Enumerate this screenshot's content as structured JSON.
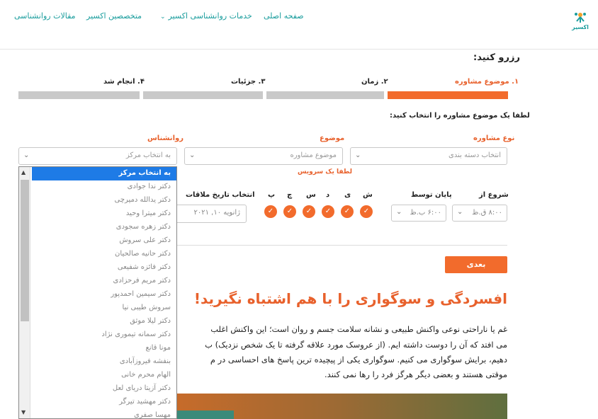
{
  "nav": {
    "home": "صفحه اصلی",
    "services": "خدمات روانشناسی اکسیر",
    "experts": "متخصصین اکسیر",
    "articles": "مقالات روانشناسی",
    "logo_text": "اکسیر"
  },
  "title": "رزرو کنید:",
  "steps": [
    {
      "label": "۱. موضوع مشاوره",
      "active": true
    },
    {
      "label": "۲. زمان",
      "active": false
    },
    {
      "label": "۳. جزئیات",
      "active": false
    },
    {
      "label": "۴. انجام شد",
      "active": false
    }
  ],
  "instruction": "لطفا یک موضوع مشاوره را انتخاب کنید:",
  "fields": {
    "category_label": "نوع مشاوره",
    "category_placeholder": "انتخاب دسته بندی",
    "topic_label": "موضوع",
    "topic_placeholder": "موضوع مشاوره",
    "topic_error": "لطفا یک سرویس",
    "psych_label": "روانشناس",
    "psych_placeholder": "به انتخاب مرکز"
  },
  "time": {
    "from_label": "شروع از",
    "from_value": "۸:۰۰ ق.ظ",
    "to_label": "پایان توسط",
    "to_value": "۶:۰۰ ب.ظ",
    "days": [
      "ش",
      "ی",
      "د",
      "س",
      "چ",
      "پ"
    ],
    "date_label": "انتخاب تاریخ ملاقات",
    "date_value": "ژانویه ۱۰, ۲۰۲۱"
  },
  "next_button": "بعدی",
  "article": {
    "title": "افسردگی و سوگواری را با هم اشتباه نگیرید!",
    "lines": [
      "غم یا ناراحتی نوعی واکنش طبیعی و نشانه سلامت جسم و روان است؛ این واکنش اغلب",
      "می افتد که آن را دوست داشته ایم. (از عروسک مورد علاقه گرفته تا یک شخص نزدیک) ب",
      "دهیم، برایش سوگواری می کنیم. سوگواری یکی از پیچیده ترین پاسخ های احساسی در م",
      "موقتی هستند و بعضی دیگر هرگز فرد را رها نمی کنند."
    ]
  },
  "dropdown": {
    "options": [
      "به انتخاب مرکز",
      "دکتر ندا جوادی",
      "دکتر یدالله دمیرچی",
      "دکتر میترا وحید",
      "دکتر زهره سجودی",
      "دکتر علی سروش",
      "دکتر حانیه صالحیان",
      "دکتر فائزه شفیعی",
      "دکتر مریم فرحزادی",
      "دکتر سیمین احمدپور",
      "سروش طیبی نیا",
      "دکتر لیلا موثق",
      "دکتر سمانه تیموری نژاد",
      "مونا قانع",
      "بنفشه فیروزآبادی",
      "الهام محرم خانی",
      "دکتر آزیتا دریای لعل",
      "دکتر مهشید تیرگر",
      "مهسا صفری"
    ],
    "selected_index": 0
  },
  "colors": {
    "accent": "#f26b2c",
    "nav": "#1a9d9d",
    "selected": "#1e7be6"
  }
}
